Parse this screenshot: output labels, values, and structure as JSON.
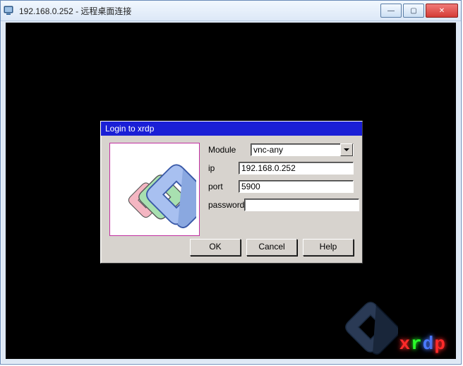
{
  "window": {
    "title": "192.168.0.252 - 远程桌面连接",
    "buttons": {
      "min": "—",
      "max": "▢",
      "close": "✕"
    }
  },
  "dialog": {
    "title": "Login to xrdp",
    "labels": {
      "module": "Module",
      "ip": "ip",
      "port": "port",
      "password": "password"
    },
    "values": {
      "module": "vnc-any",
      "ip": "192.168.0.252",
      "port": "5900",
      "password": ""
    },
    "buttons": {
      "ok": "OK",
      "cancel": "Cancel",
      "help": "Help"
    }
  },
  "brand": {
    "x": "x",
    "r": "r",
    "d": "d",
    "p": "p"
  }
}
